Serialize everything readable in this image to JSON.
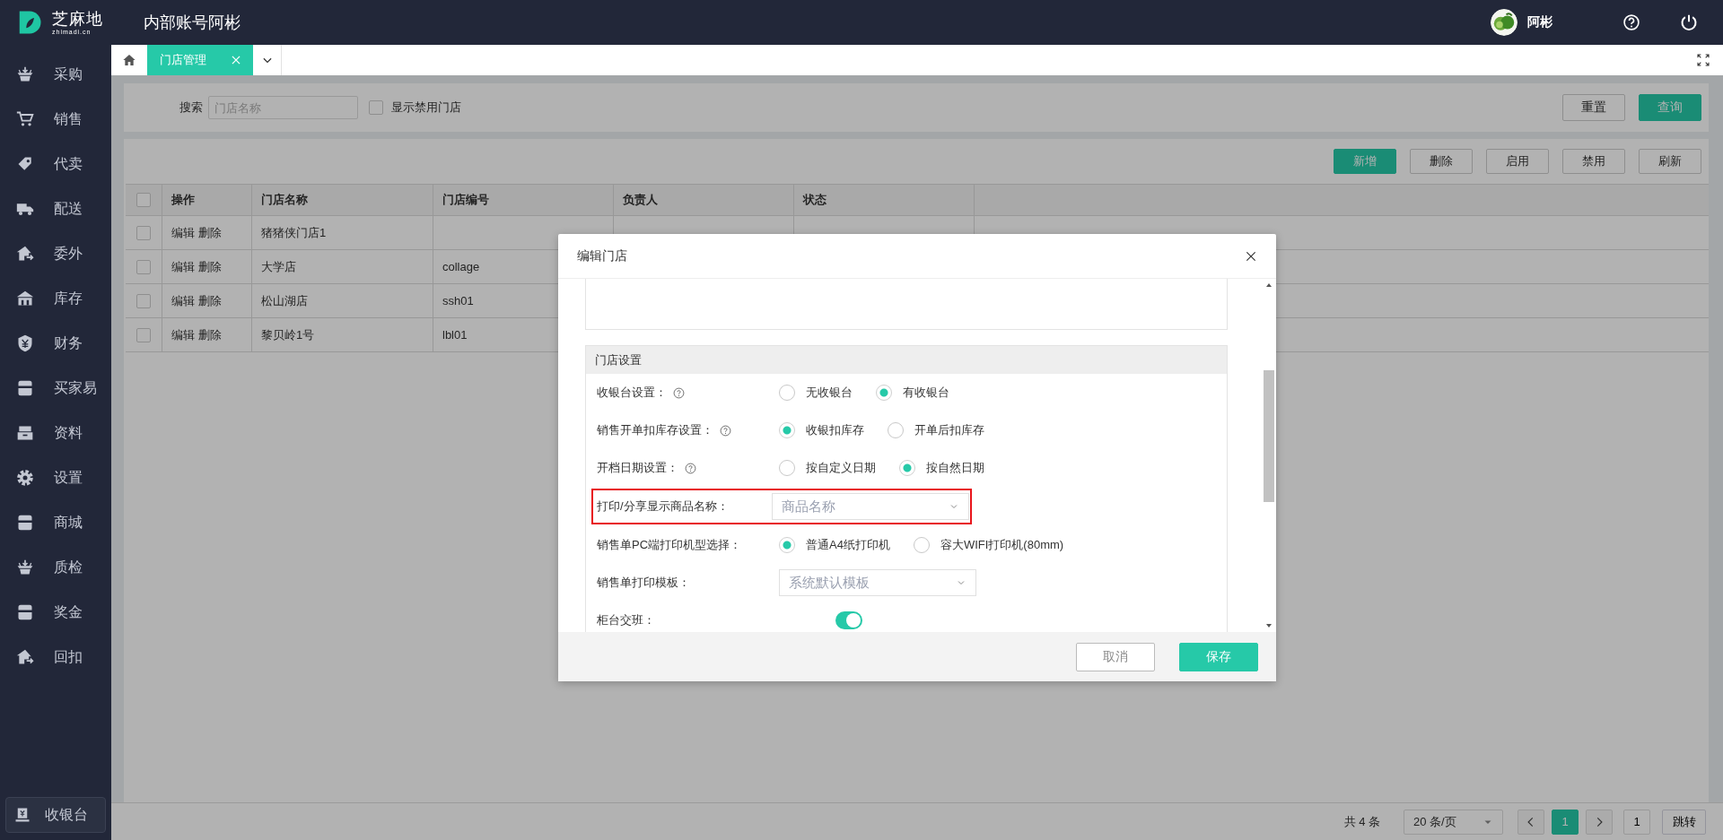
{
  "header": {
    "logo_text": "芝麻地",
    "logo_subtext": "zhimadi.cn",
    "title": "内部账号阿彬",
    "user": "阿彬"
  },
  "sidebar": {
    "items": [
      {
        "label": "采购"
      },
      {
        "label": "销售"
      },
      {
        "label": "代卖"
      },
      {
        "label": "配送"
      },
      {
        "label": "委外"
      },
      {
        "label": "库存"
      },
      {
        "label": "财务"
      },
      {
        "label": "买家易"
      },
      {
        "label": "资料"
      },
      {
        "label": "设置"
      },
      {
        "label": "商城"
      },
      {
        "label": "质检"
      },
      {
        "label": "奖金"
      },
      {
        "label": "回扣"
      }
    ],
    "cashier": "收银台"
  },
  "tabs": [
    {
      "label": "门店管理",
      "selected": true
    }
  ],
  "search": {
    "label": "搜索",
    "placeholder": "门店名称",
    "checkbox_label": "显示禁用门店",
    "checked": false,
    "buttons": [
      {
        "label": "重置",
        "kind": "default"
      },
      {
        "label": "查询",
        "kind": "primary"
      }
    ]
  },
  "toolbar": [
    {
      "label": "新增",
      "kind": "primary"
    },
    {
      "label": "删除",
      "kind": "default"
    },
    {
      "label": "启用",
      "kind": "default"
    },
    {
      "label": "禁用",
      "kind": "default"
    },
    {
      "label": "刷新",
      "kind": "default"
    }
  ],
  "table": {
    "header_checked": false,
    "columns": [
      "操作",
      "门店名称",
      "门店编号",
      "负责人",
      "状态"
    ],
    "rows": [
      {
        "checked": false,
        "actions": [
          "编辑",
          "删除"
        ],
        "store_name": "猪猪侠门店1"
      },
      {
        "checked": false,
        "actions": [
          "编辑",
          "删除"
        ],
        "store_name": "大学店",
        "store_code": "collage"
      },
      {
        "checked": false,
        "actions": [
          "编辑",
          "删除"
        ],
        "store_name": "松山湖店",
        "store_code": "ssh01"
      },
      {
        "checked": false,
        "actions": [
          "编辑",
          "删除"
        ],
        "store_name": "黎贝岭1号",
        "store_code": "lbl01"
      }
    ]
  },
  "pagination": {
    "total": "共 4 条",
    "page_size": "20 条/页",
    "pages": [
      {
        "label": "1",
        "selected": true
      }
    ],
    "jump_value": "1",
    "jump_button": "跳转"
  },
  "modal": {
    "title": "编辑门店",
    "section": "门店设置",
    "fields": [
      {
        "kind": "radio",
        "label": "收银台设置：",
        "help": true,
        "options": [
          {
            "label": "无收银台",
            "selected": false
          },
          {
            "label": "有收银台",
            "selected": true
          }
        ]
      },
      {
        "kind": "radio",
        "label": "销售开单扣库存设置：",
        "help": true,
        "options": [
          {
            "label": "收银扣库存",
            "selected": true
          },
          {
            "label": "开单后扣库存",
            "selected": false
          }
        ]
      },
      {
        "kind": "radio",
        "label": "开档日期设置：",
        "help": true,
        "options": [
          {
            "label": "按自定义日期",
            "selected": false
          },
          {
            "label": "按自然日期",
            "selected": true
          }
        ]
      },
      {
        "kind": "select",
        "label": "打印/分享显示商品名称：",
        "value": "商品名称",
        "highlighted": true
      },
      {
        "kind": "radio",
        "label": "销售单PC端打印机型选择：",
        "help": false,
        "options": [
          {
            "label": "普通A4纸打印机",
            "selected": true
          },
          {
            "label": "容大WIFI打印机(80mm)",
            "selected": false
          }
        ]
      },
      {
        "kind": "select",
        "label": "销售单打印模板：",
        "value": "系统默认模板",
        "highlighted": false
      },
      {
        "kind": "switch",
        "label": "柜台交班：",
        "on": true
      }
    ],
    "buttons": [
      {
        "label": "取消",
        "kind": "default"
      },
      {
        "label": "保存",
        "kind": "primary"
      }
    ]
  }
}
